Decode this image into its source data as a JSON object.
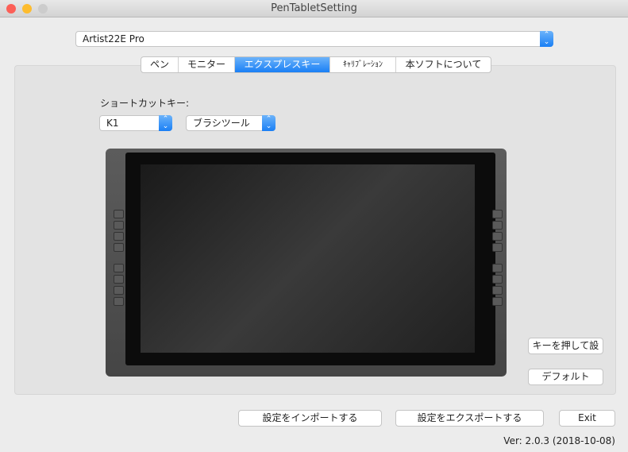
{
  "window": {
    "title": "PenTabletSetting"
  },
  "device_select": {
    "value": "Artist22E Pro"
  },
  "tabs": [
    {
      "label": "ペン"
    },
    {
      "label": "モニター"
    },
    {
      "label": "エクスプレスキー",
      "active": true
    },
    {
      "label": "ｷｬﾘﾌﾞﾚｰｼｮﾝ"
    },
    {
      "label": "本ソフトについて"
    }
  ],
  "express": {
    "shortcut_label": "ショートカットキー:",
    "key_select": "K1",
    "function_select": "ブラシツール",
    "press_key_button": "キーを押して設",
    "default_button": "デフォルト"
  },
  "footer": {
    "import_button": "設定をインポートする",
    "export_button": "設定をエクスポートする",
    "exit_button": "Exit",
    "version": "Ver: 2.0.3 (2018-10-08)"
  }
}
